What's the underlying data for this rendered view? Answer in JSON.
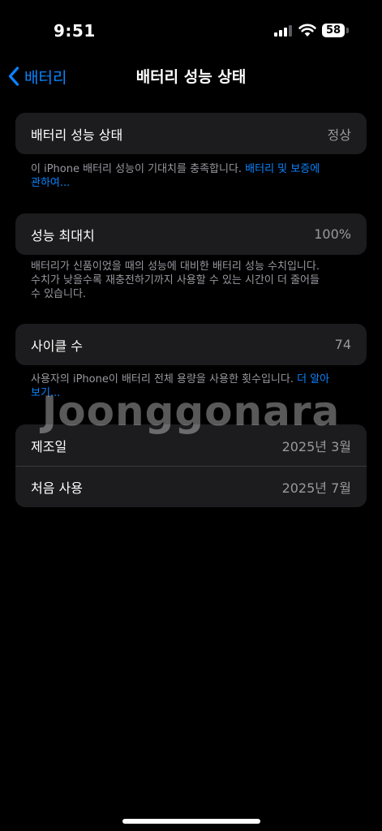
{
  "status_bar": {
    "time": "9:51",
    "battery_level": "58"
  },
  "nav": {
    "back_label": "배터리",
    "title": "배터리 성능 상태"
  },
  "health": {
    "label": "배터리 성능 상태",
    "value": "정상"
  },
  "health_note": {
    "text": "이 iPhone 배터리 성능이 기대치를 충족합니다. ",
    "link": "배터리 및 보증에 관하여..."
  },
  "capacity": {
    "label": "성능 최대치",
    "value": "100%"
  },
  "capacity_note": {
    "text": "배터리가 신품이었을 때의 성능에 대비한 배터리 성능 수치입니다. 수치가 낮을수록 재충전하기까지 사용할 수 있는 시간이 더 줄어들 수 있습니다."
  },
  "cycles": {
    "label": "사이클 수",
    "value": "74"
  },
  "cycles_note": {
    "text": "사용자의 iPhone이 배터리 전체 용량을 사용한 횟수입니다. ",
    "link": "더 알아보기..."
  },
  "details": {
    "manufacture": {
      "label": "제조일",
      "value": "2025년 3월"
    },
    "first_use": {
      "label": "처음 사용",
      "value": "2025년 7월"
    }
  },
  "watermark": "Joonggonara",
  "colors": {
    "accent": "#0a84ff",
    "card": "#1c1c1e",
    "background": "#000000",
    "secondary_text": "#98989f"
  }
}
